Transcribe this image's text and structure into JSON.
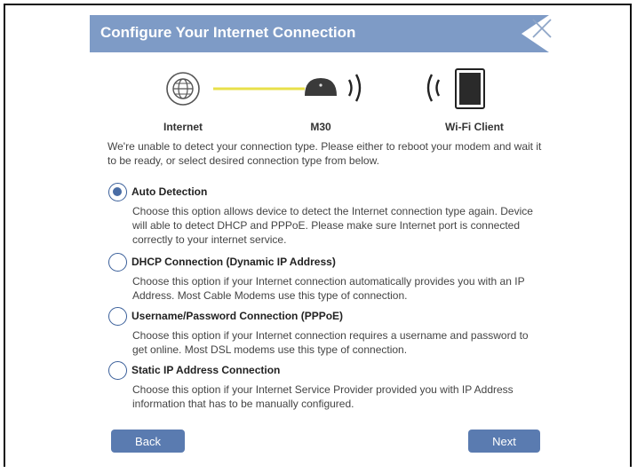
{
  "dialog": {
    "title": "Configure Your Internet Connection"
  },
  "diagram": {
    "internet_label": "Internet",
    "device_label": "M30",
    "client_label": "Wi-Fi Client"
  },
  "intro_text": "We're unable to detect your connection type. Please either to reboot your modem and wait it to be ready, or select desired connection type from below.",
  "options": [
    {
      "label": "Auto Detection",
      "description": "Choose this option allows device to detect the Internet connection type again. Device will able to detect DHCP and PPPoE. Please make sure Internet port is connected correctly to your internet service.",
      "selected": true
    },
    {
      "label": "DHCP Connection (Dynamic IP Address)",
      "description": "Choose this option if your Internet connection automatically provides you with an IP Address. Most Cable Modems use this type of connection.",
      "selected": false
    },
    {
      "label": "Username/Password Connection (PPPoE)",
      "description": "Choose this option if your Internet connection requires a username and password to get online. Most DSL modems use this type of connection.",
      "selected": false
    },
    {
      "label": "Static IP Address Connection",
      "description": "Choose this option if your Internet Service Provider provided you with IP Address information that has to be manually configured.",
      "selected": false
    }
  ],
  "buttons": {
    "back_label": "Back",
    "next_label": "Next"
  },
  "colors": {
    "header": "#7e9bc6",
    "button": "#5a7bb0",
    "link_line": "#e8e04a",
    "radio": "#4a6da5"
  }
}
